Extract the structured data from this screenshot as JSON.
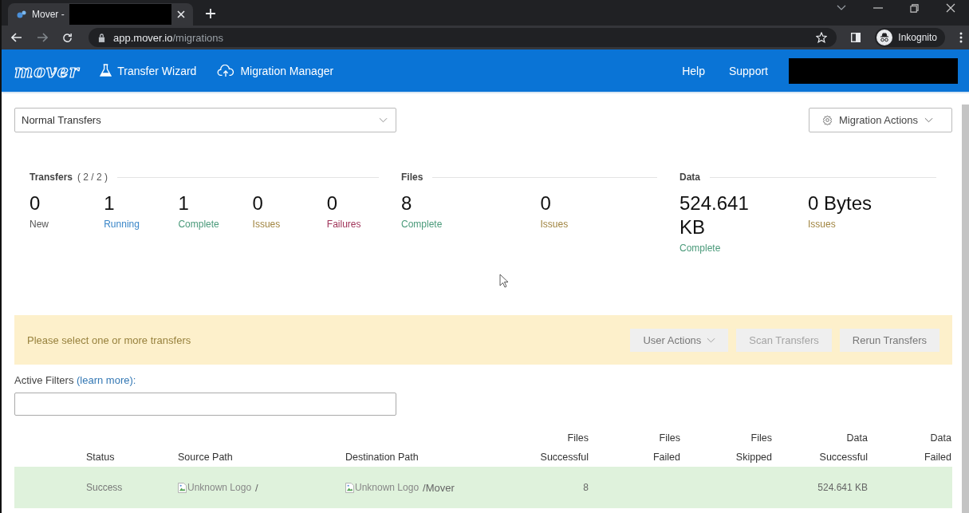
{
  "browser": {
    "tab_title": "Mover -",
    "url": {
      "host": "app.mover.io",
      "path": "/migrations"
    },
    "profile": "Inkognito"
  },
  "nav": {
    "logo": "mover",
    "items": [
      {
        "label": "Transfer Wizard",
        "kind": "wizard"
      },
      {
        "label": "Migration Manager",
        "kind": "manager"
      }
    ],
    "links": [
      "Help",
      "Support"
    ]
  },
  "toolbar": {
    "transfer_filter": {
      "value": "Normal Transfers"
    },
    "actions_button": "Migration Actions"
  },
  "stats": {
    "groups": [
      {
        "title": "Transfers",
        "count": "( 2 / 2 )",
        "items": [
          {
            "value": "0",
            "label": "New",
            "color": "#555555"
          },
          {
            "value": "1",
            "label": "Running",
            "color": "#3a86c8"
          },
          {
            "value": "1",
            "label": "Complete",
            "color": "#4a9a7a"
          },
          {
            "value": "0",
            "label": "Issues",
            "color": "#a08440"
          },
          {
            "value": "0",
            "label": "Failures",
            "color": "#a0355a"
          }
        ]
      },
      {
        "title": "Files",
        "items": [
          {
            "value": "8",
            "label": "Complete",
            "color": "#4a9a7a"
          },
          {
            "value": "0",
            "label": "Issues",
            "color": "#a08440"
          }
        ]
      },
      {
        "title": "Data",
        "items": [
          {
            "value": "524.641 KB",
            "label": "Complete",
            "color": "#4a9a7a"
          },
          {
            "value": "0 Bytes",
            "label": "Issues",
            "color": "#a08440"
          }
        ]
      }
    ]
  },
  "selection_bar": {
    "message": "Please select one or more transfers",
    "buttons": [
      {
        "label": "User Actions",
        "dropdown": true,
        "disabled": false
      },
      {
        "label": "Scan Transfers",
        "dropdown": false,
        "disabled": true
      },
      {
        "label": "Rerun Transfers",
        "dropdown": false,
        "disabled": false
      }
    ]
  },
  "filters": {
    "label": "Active Filters",
    "link": "(learn more):"
  },
  "table": {
    "columns": [
      {
        "lines": [
          "Status"
        ]
      },
      {
        "lines": [
          "Source Path"
        ]
      },
      {
        "lines": [
          "Destination Path"
        ]
      },
      {
        "lines": [
          "Files",
          "Successful"
        ]
      },
      {
        "lines": [
          "Files",
          "Failed"
        ]
      },
      {
        "lines": [
          "Files",
          "Skipped"
        ]
      },
      {
        "lines": [
          "Data",
          "Successful"
        ]
      },
      {
        "lines": [
          "Data",
          "Failed"
        ]
      }
    ],
    "rows": [
      {
        "kind": "success",
        "cells": [
          {
            "kind": "text",
            "text": "Success"
          },
          {
            "kind": "path",
            "logo": "Unknown Logo",
            "path": "/"
          },
          {
            "kind": "path",
            "logo": "Unknown Logo",
            "path": "/Mover"
          },
          {
            "kind": "text",
            "text": "8"
          },
          null,
          null,
          {
            "kind": "text",
            "text": "524.641 KB"
          },
          null
        ]
      }
    ]
  }
}
